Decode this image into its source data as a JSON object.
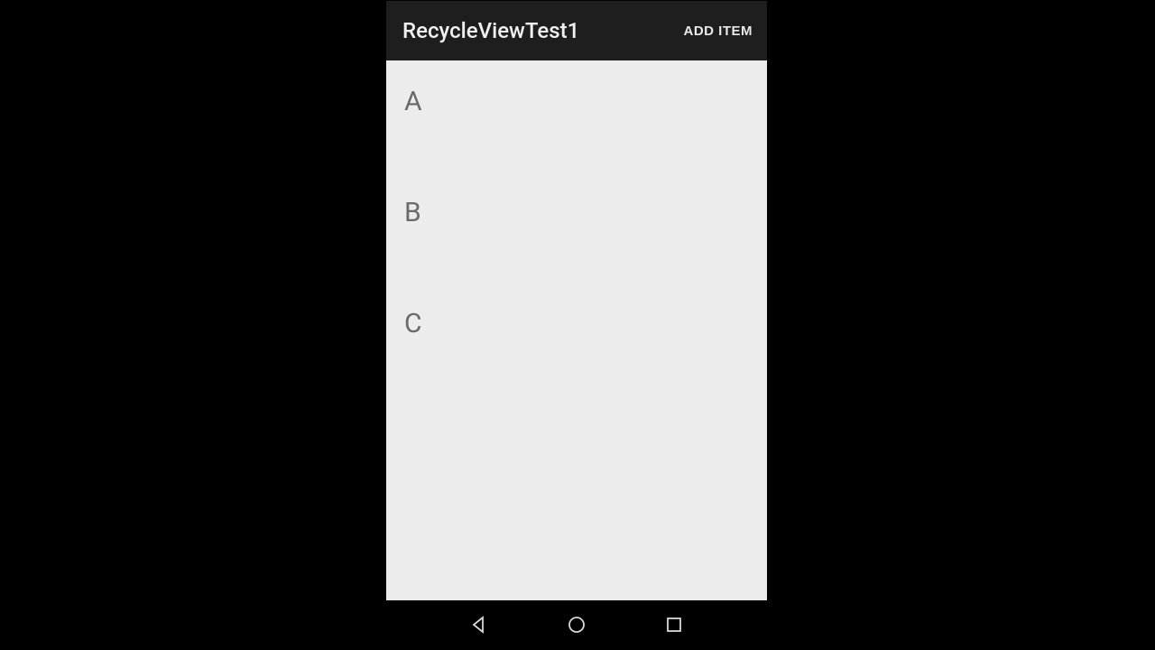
{
  "appBar": {
    "title": "RecycleViewTest1",
    "addItemLabel": "ADD ITEM"
  },
  "list": {
    "items": [
      {
        "label": "A"
      },
      {
        "label": "B"
      },
      {
        "label": "C"
      }
    ]
  },
  "navBar": {
    "backIcon": "back-icon",
    "homeIcon": "home-icon",
    "recentIcon": "recent-icon"
  }
}
